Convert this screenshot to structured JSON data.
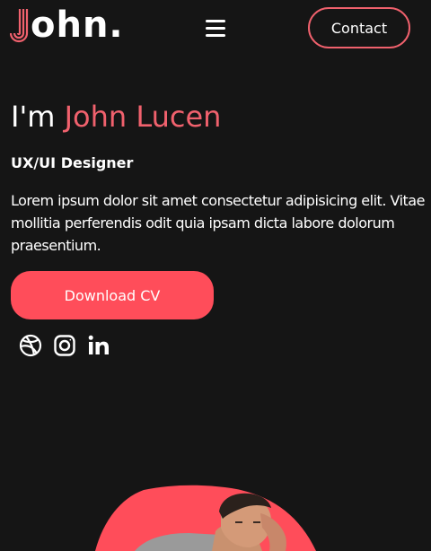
{
  "header": {
    "logo_rest": "ohn.",
    "menu_icon": "hamburger-icon",
    "contact_label": "Contact"
  },
  "hero": {
    "greeting": "I'm ",
    "name": "John Lucen",
    "role": "UX/UI Designer",
    "bio": "Lorem ipsum dolor sit amet consectetur adipisicing elit. Vitae mollitia perferendis odit quia ipsam dicta labore dolorum praesentium.",
    "cta_label": "Download CV"
  },
  "socials": [
    {
      "icon": "dribbble-icon"
    },
    {
      "icon": "instagram-icon"
    },
    {
      "icon": "linkedin-icon"
    }
  ],
  "colors": {
    "background": "#151515",
    "accent": "#f0616d",
    "button": "#ff4d5a",
    "text": "#ffffff"
  }
}
